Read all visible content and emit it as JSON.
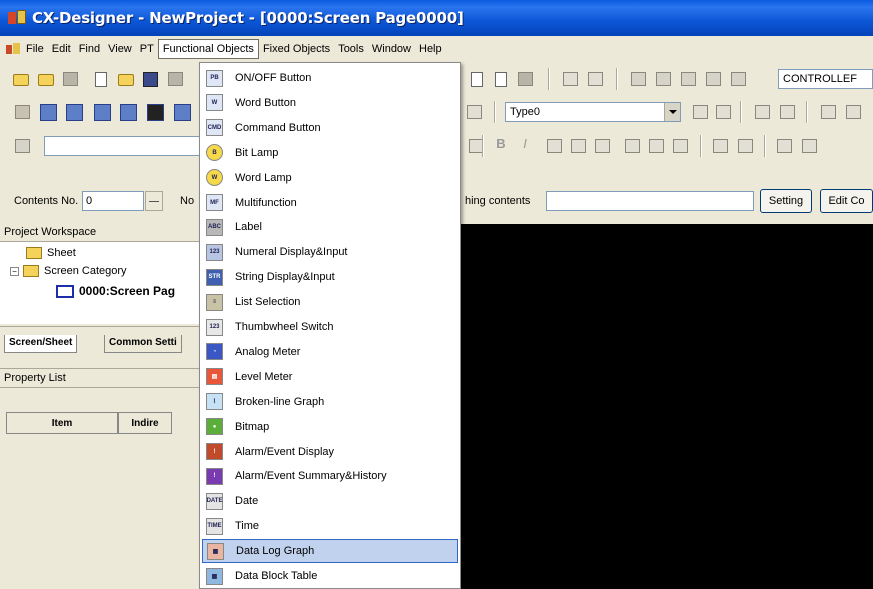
{
  "window": {
    "title": "CX-Designer - NewProject - [0000:Screen Page0000]"
  },
  "menubar": {
    "items": [
      "File",
      "Edit",
      "Find",
      "View",
      "PT",
      "Functional Objects",
      "Fixed Objects",
      "Tools",
      "Window",
      "Help"
    ]
  },
  "toolbar": {
    "controller_combo": "CONTROLLEF",
    "type_combo": "Type0"
  },
  "contents": {
    "label": "Contents No.",
    "value": "0",
    "no_label": "No",
    "switching_label": "hing contents",
    "setting_button": "Setting",
    "edit_button": "Edit Co"
  },
  "workspace": {
    "header": "Project Workspace",
    "tree": [
      {
        "label": "Sheet"
      },
      {
        "label": "Screen Category"
      },
      {
        "label": "0000:Screen Pag"
      }
    ],
    "tabs": [
      "Screen/Sheet",
      "Common Setti"
    ]
  },
  "property_list": {
    "header": "Property List",
    "columns": [
      "Item",
      "Indire"
    ]
  },
  "functional_objects_menu": {
    "items": [
      {
        "label": "ON/OFF Button",
        "icon": "onoff-button-icon",
        "glyph": "PB",
        "color": "#dfe6f5"
      },
      {
        "label": "Word Button",
        "icon": "word-button-icon",
        "glyph": "W",
        "color": "#dfe6f5"
      },
      {
        "label": "Command Button",
        "icon": "command-button-icon",
        "glyph": "CMD",
        "color": "#dfe6f5"
      },
      {
        "label": "Bit Lamp",
        "icon": "bit-lamp-icon",
        "glyph": "B",
        "color": "#f5d94a"
      },
      {
        "label": "Word Lamp",
        "icon": "word-lamp-icon",
        "glyph": "W",
        "color": "#f5d94a"
      },
      {
        "label": "Multifunction",
        "icon": "multifunction-icon",
        "glyph": "MF",
        "color": "#dfe6f5"
      },
      {
        "label": "Label",
        "icon": "label-icon",
        "glyph": "ABC",
        "color": "#b8b8b8"
      },
      {
        "label": "Numeral Display&Input",
        "icon": "numeral-display-icon",
        "glyph": "123",
        "color": "#b9c6e3"
      },
      {
        "label": "String Display&Input",
        "icon": "string-display-icon",
        "glyph": "STR",
        "color": "#3f5fb0"
      },
      {
        "label": "List Selection",
        "icon": "list-selection-icon",
        "glyph": "≡",
        "color": "#c9c3a6"
      },
      {
        "label": "Thumbwheel Switch",
        "icon": "thumbwheel-icon",
        "glyph": "123",
        "color": "#e7e7e7"
      },
      {
        "label": "Analog Meter",
        "icon": "analog-meter-icon",
        "glyph": "◔",
        "color": "#3b57c4"
      },
      {
        "label": "Level Meter",
        "icon": "level-meter-icon",
        "glyph": "▤",
        "color": "#e9563a"
      },
      {
        "label": "Broken-line Graph",
        "icon": "line-graph-icon",
        "glyph": "⌇",
        "color": "#c8e2f5"
      },
      {
        "label": "Bitmap",
        "icon": "bitmap-icon",
        "glyph": "●",
        "color": "#5cae3a"
      },
      {
        "label": "Alarm/Event Display",
        "icon": "alarm-display-icon",
        "glyph": "!",
        "color": "#c04a2a"
      },
      {
        "label": "Alarm/Event Summary&History",
        "icon": "alarm-history-icon",
        "glyph": "!",
        "color": "#7a3ab0"
      },
      {
        "label": "Date",
        "icon": "date-icon",
        "glyph": "DATE",
        "color": "#e4e4e4"
      },
      {
        "label": "Time",
        "icon": "time-icon",
        "glyph": "TIME",
        "color": "#e4e4e4"
      },
      {
        "label": "Data Log Graph",
        "icon": "data-log-graph-icon",
        "glyph": "▦",
        "color": "#e8b5a2",
        "highlighted": true
      },
      {
        "label": "Data Block Table",
        "icon": "data-block-table-icon",
        "glyph": "▦",
        "color": "#8fb8e0"
      }
    ]
  }
}
